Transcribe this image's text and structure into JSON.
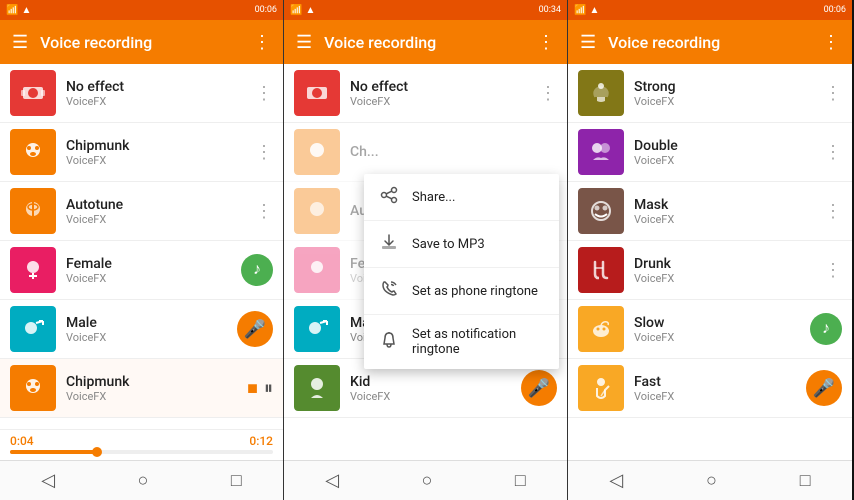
{
  "panels": [
    {
      "id": "panel1",
      "status": {
        "left": "📶📶",
        "time": "00:06"
      },
      "appbar": {
        "hamburger": "☰",
        "title": "Voice recording",
        "more": "⋮"
      },
      "items": [
        {
          "id": "no-effect",
          "thumb_class": "thumb-red",
          "icon": "🎙",
          "title": "No effect",
          "sub": "VoiceFX",
          "has_more": true
        },
        {
          "id": "chipmunk",
          "thumb_class": "thumb-orange",
          "icon": "🐿",
          "title": "Chipmunk",
          "sub": "VoiceFX",
          "has_more": true
        },
        {
          "id": "autotune",
          "thumb_class": "thumb-orange",
          "icon": "🎤",
          "title": "Autotune",
          "sub": "VoiceFX",
          "has_more": true
        },
        {
          "id": "female",
          "thumb_class": "thumb-pink",
          "icon": "♀",
          "title": "Female",
          "sub": "VoiceFX",
          "has_action": "green"
        },
        {
          "id": "male",
          "thumb_class": "thumb-teal",
          "icon": "♂",
          "title": "Male",
          "sub": "VoiceFX",
          "has_action": "orange"
        },
        {
          "id": "chipmunk2",
          "thumb_class": "thumb-orange",
          "icon": "🐿",
          "title": "Chipmunk",
          "sub": "VoiceFX",
          "recording": true
        }
      ],
      "recording": {
        "time_start": "0:04",
        "time_end": "0:12"
      },
      "nav": [
        "◁",
        "○",
        "□"
      ]
    },
    {
      "id": "panel2",
      "status": {
        "left": "📶📶",
        "time": "00:34"
      },
      "appbar": {
        "hamburger": "☰",
        "title": "Voice recording",
        "more": "⋮"
      },
      "items": [
        {
          "id": "no-effect",
          "thumb_class": "thumb-red",
          "icon": "🎙",
          "title": "No effect",
          "sub": "VoiceFX",
          "has_more": true
        },
        {
          "id": "chipmunk-blur",
          "thumb_class": "thumb-orange",
          "icon": "🐿",
          "title": "Ch...",
          "sub": "",
          "blurred": true
        },
        {
          "id": "autotune-blur",
          "thumb_class": "thumb-orange",
          "icon": "🎤",
          "title": "Au...",
          "sub": "",
          "blurred": true
        },
        {
          "id": "female-blur",
          "thumb_class": "thumb-pink",
          "icon": "♀",
          "title": "Fe...",
          "sub": "VoiceFX",
          "blurred": true
        },
        {
          "id": "male",
          "thumb_class": "thumb-teal",
          "icon": "♂",
          "title": "Male",
          "sub": "VoiceFX",
          "has_more": true
        },
        {
          "id": "kid",
          "thumb_class": "thumb-green-dark",
          "icon": "👦",
          "title": "Kid",
          "sub": "VoiceFX",
          "has_action": "orange"
        }
      ],
      "dropdown": {
        "items": [
          {
            "icon": "share",
            "label": "Share..."
          },
          {
            "icon": "save",
            "label": "Save to MP3"
          },
          {
            "icon": "phone",
            "label": "Set as phone ringtone"
          },
          {
            "icon": "bell",
            "label": "Set as notification ringtone"
          }
        ]
      },
      "nav": [
        "◁",
        "○",
        "□"
      ]
    },
    {
      "id": "panel3",
      "status": {
        "left": "📶📶",
        "time": "00:06"
      },
      "appbar": {
        "hamburger": "☰",
        "title": "Voice recording",
        "more": "⋮"
      },
      "items": [
        {
          "id": "strong",
          "thumb_class": "thumb-olive",
          "icon": "💪",
          "title": "Strong",
          "sub": "VoiceFX",
          "has_more": true
        },
        {
          "id": "double",
          "thumb_class": "thumb-purple",
          "icon": "👥",
          "title": "Double",
          "sub": "VoiceFX",
          "has_more": true
        },
        {
          "id": "mask",
          "thumb_class": "thumb-brown",
          "icon": "😷",
          "title": "Mask",
          "sub": "VoiceFX",
          "has_more": true
        },
        {
          "id": "drunk",
          "thumb_class": "thumb-dark-red",
          "icon": "🍻",
          "title": "Drunk",
          "sub": "VoiceFX",
          "has_more": true
        },
        {
          "id": "slow",
          "thumb_class": "thumb-amber",
          "icon": "🐌",
          "title": "Slow",
          "sub": "VoiceFX",
          "has_action": "green"
        },
        {
          "id": "fast",
          "thumb_class": "thumb-amber",
          "icon": "🏃",
          "title": "Fast",
          "sub": "VoiceFX",
          "has_action": "orange"
        }
      ],
      "nav": [
        "◁",
        "○",
        "□"
      ]
    }
  ]
}
